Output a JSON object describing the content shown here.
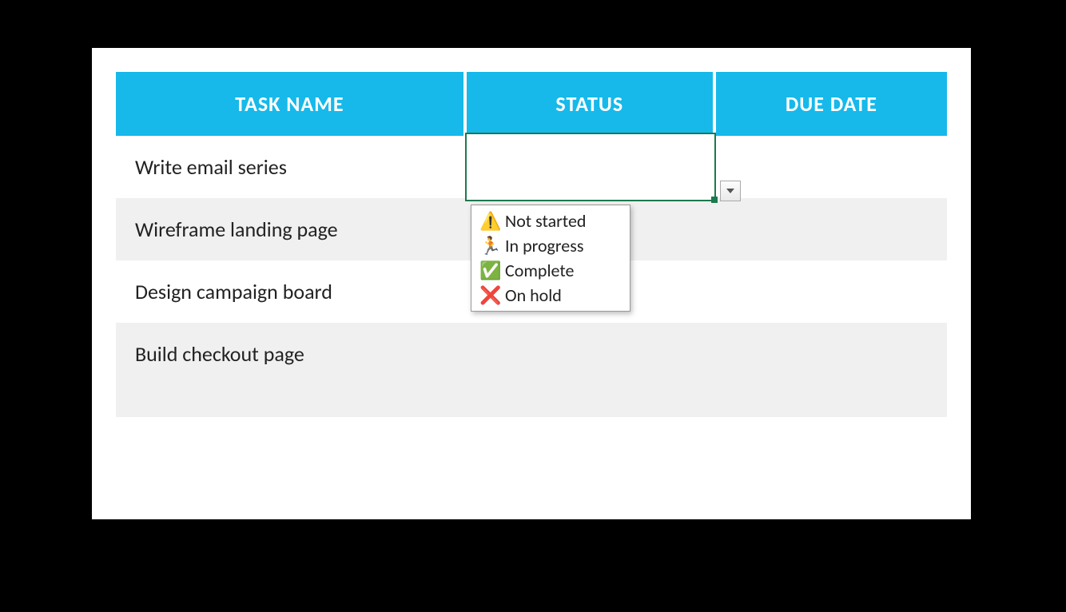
{
  "table": {
    "columns": {
      "task": "TASK NAME",
      "status": "STATUS",
      "due": "DUE DATE"
    },
    "rows": [
      {
        "task": "Write email series",
        "status": "",
        "due": ""
      },
      {
        "task": "Wireframe landing page",
        "status": "",
        "due": ""
      },
      {
        "task": "Design campaign board",
        "status": "",
        "due": ""
      },
      {
        "task": "Build checkout page",
        "status": "",
        "due": ""
      }
    ]
  },
  "dropdown": {
    "options": [
      {
        "emoji": "⚠️",
        "label": "Not started"
      },
      {
        "emoji": "🏃",
        "label": "In progress"
      },
      {
        "emoji": "✅",
        "label": "Complete"
      },
      {
        "emoji": "❌",
        "label": "On hold"
      }
    ]
  }
}
